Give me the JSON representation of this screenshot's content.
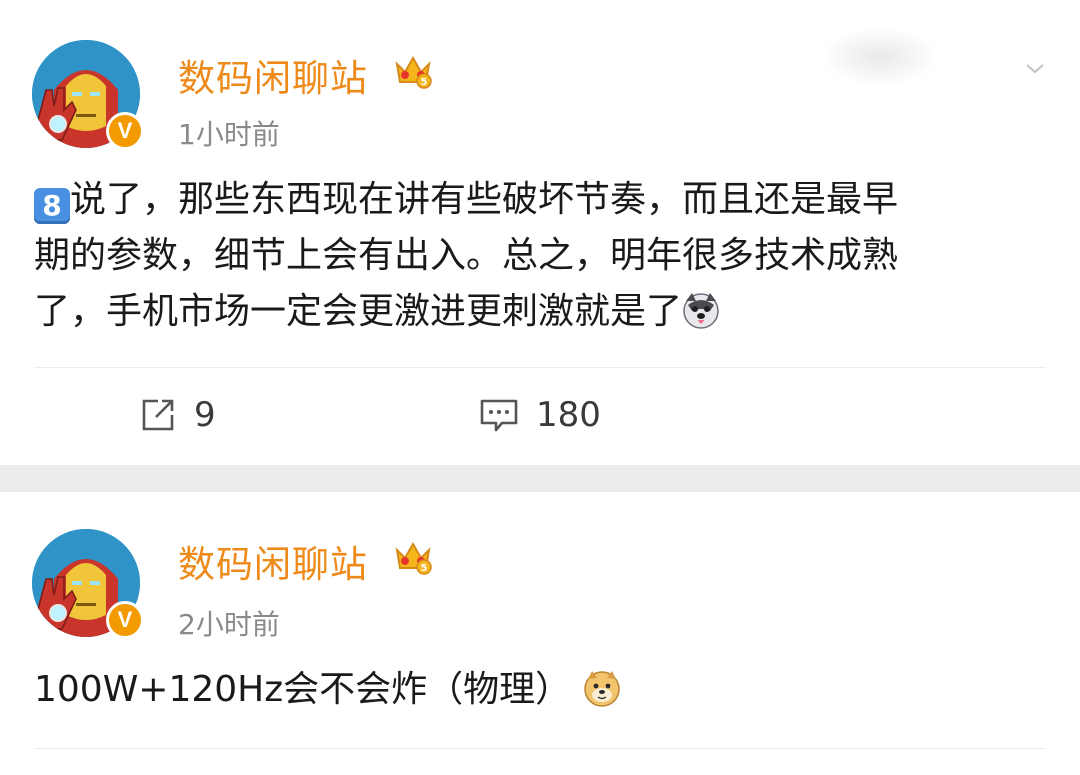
{
  "posts": [
    {
      "username": "数码闲聊站",
      "timestamp": "1小时前",
      "content": {
        "lead_emoji": "8",
        "line1": "说了，那些东西现在讲有些破坏节奏，而且还是最早",
        "line2": "期的参数，细节上会有出入。总之，明年很多技术成熟",
        "line3": "了，手机市场一定会更激进更刺激就是了"
      },
      "repost_count": "9",
      "comment_count": "180"
    },
    {
      "username": "数码闲聊站",
      "timestamp": "2小时前",
      "content": {
        "line1": "100W+120Hz会不会炸（物理）"
      }
    }
  ],
  "icons": {
    "verified_badge": "V",
    "crown": "crown-icon",
    "repost": "repost-icon",
    "comment": "comment-icon",
    "husky_emoji": "husky-emoji",
    "doge_emoji": "doge-emoji",
    "collapse": "chevron-down-icon"
  },
  "colors": {
    "username": "#ee8a1a",
    "timestamp": "#8a8a8a",
    "verified": "#f29a00",
    "separator": "#ececec"
  }
}
